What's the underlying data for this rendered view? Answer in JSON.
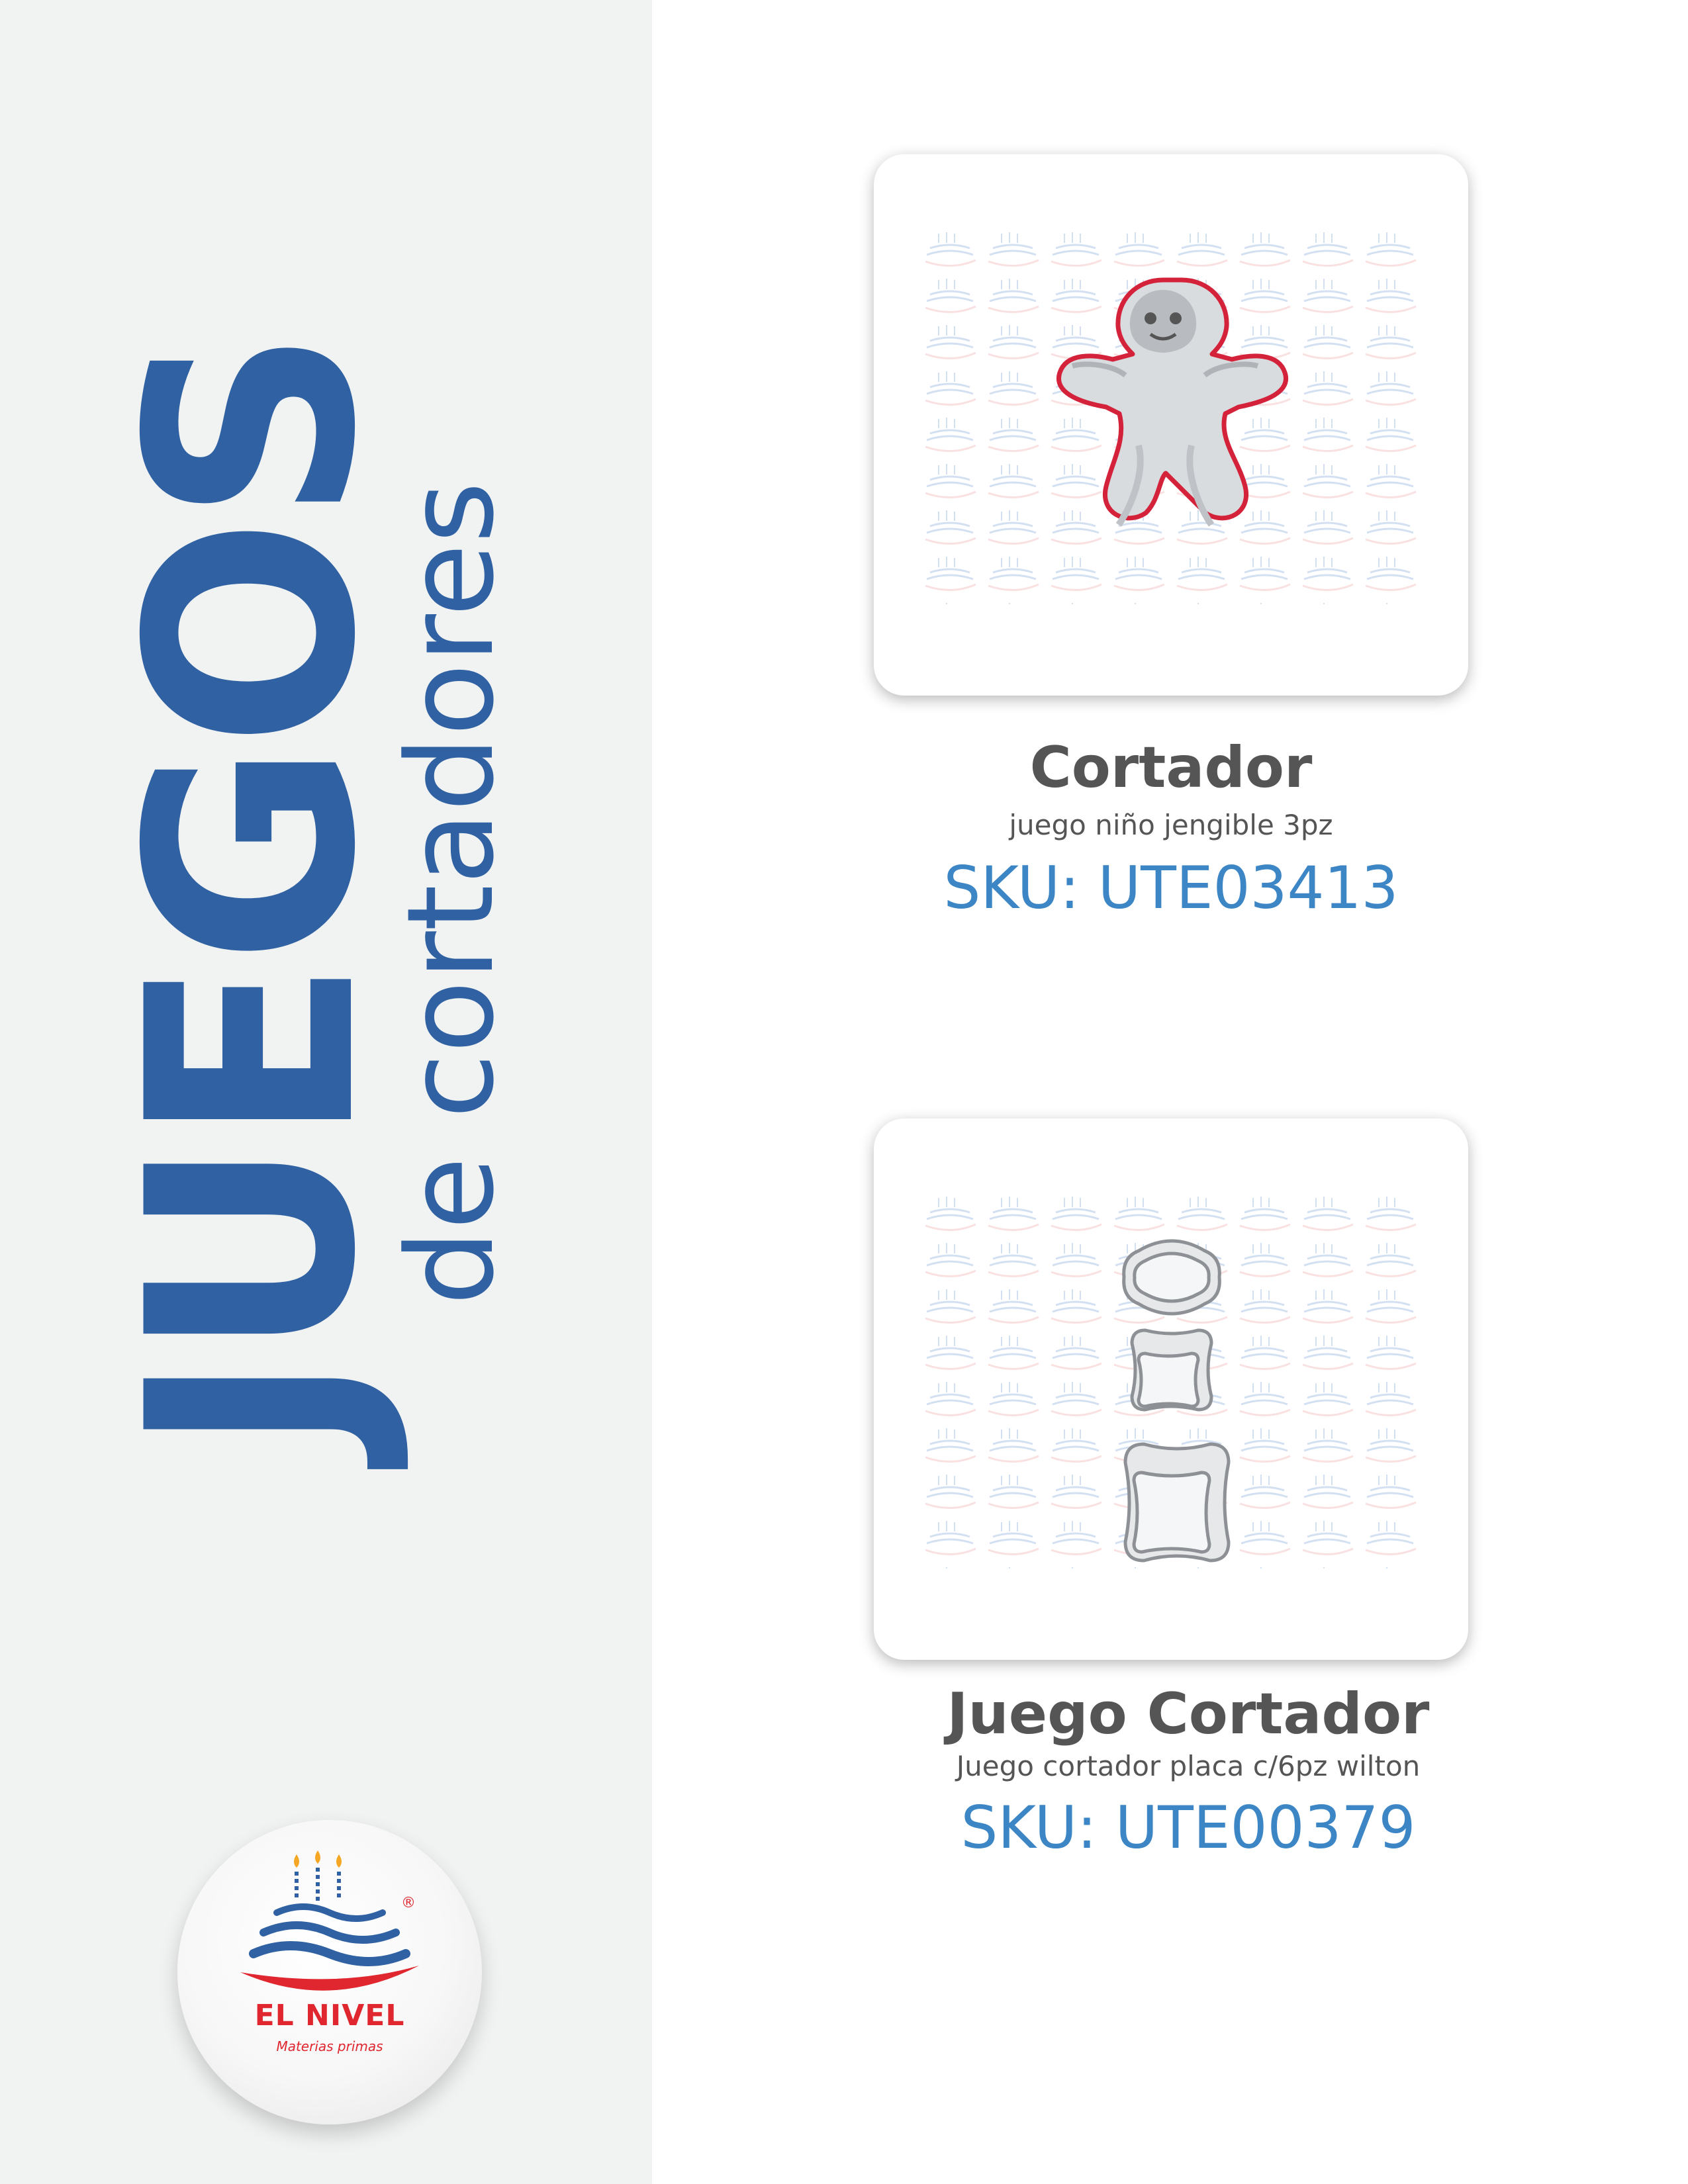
{
  "sidebar": {
    "title_big": "JUEGOS",
    "title_small": "de cortadores",
    "logo": {
      "brand": "EL NIVEL",
      "tagline": "Materias primas",
      "mark": "®"
    }
  },
  "products": [
    {
      "title": "Cortador",
      "description": "juego niño jengible 3pz",
      "sku": "SKU: UTE03413",
      "image": "gingerbread-cutter-image"
    },
    {
      "title": "Juego Cortador",
      "description": "Juego cortador placa c/6pz wilton",
      "sku": "SKU: UTE00379",
      "image": "plaque-cutter-set-image"
    }
  ],
  "colors": {
    "accent_blue": "#2f61a3",
    "sku_blue": "#3d86c6",
    "text_gray": "#555555",
    "brand_red": "#e0262e",
    "sidebar_bg": "#f1f2f2"
  }
}
